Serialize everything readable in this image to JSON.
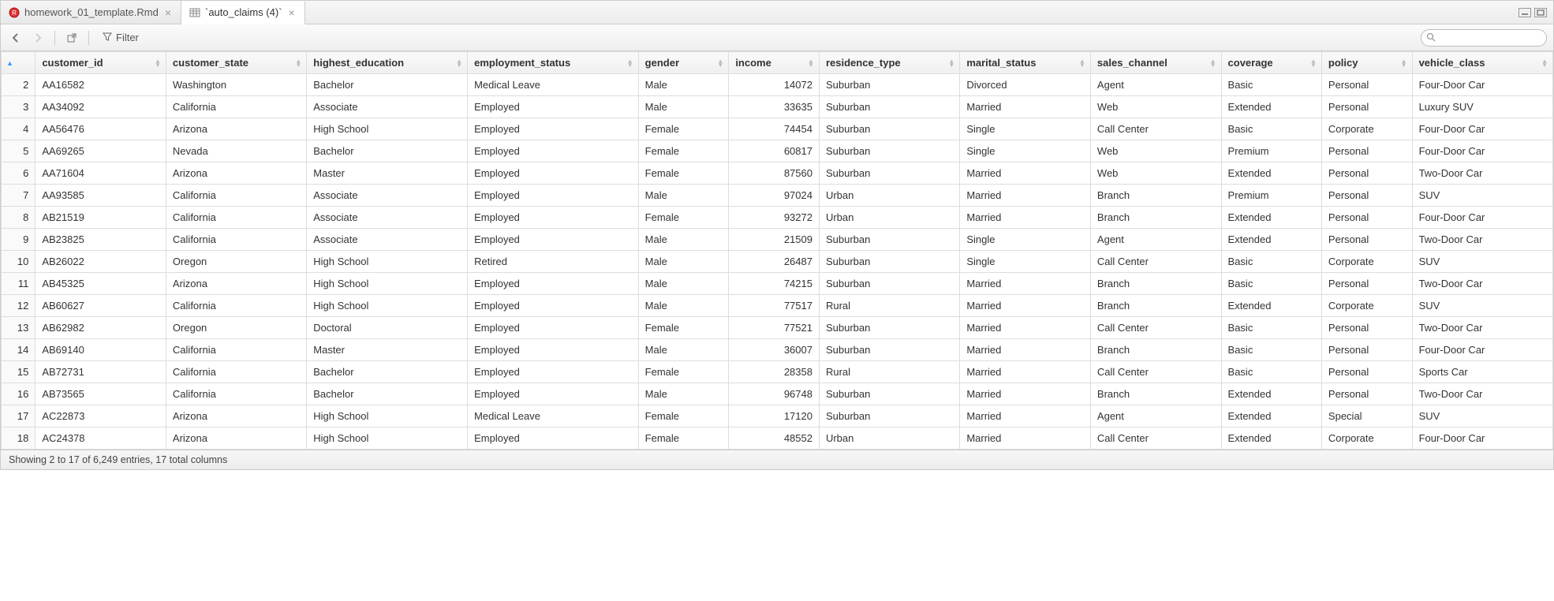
{
  "tabs": [
    {
      "label": "homework_01_template.Rmd",
      "icon": "rmd",
      "active": false
    },
    {
      "label": "`auto_claims (4)`",
      "icon": "table",
      "active": true
    }
  ],
  "toolbar": {
    "filter_label": "Filter",
    "search_placeholder": ""
  },
  "columns": [
    {
      "key": "customer_id",
      "label": "customer_id",
      "type": "text"
    },
    {
      "key": "customer_state",
      "label": "customer_state",
      "type": "text"
    },
    {
      "key": "highest_education",
      "label": "highest_education",
      "type": "text"
    },
    {
      "key": "employment_status",
      "label": "employment_status",
      "type": "text"
    },
    {
      "key": "gender",
      "label": "gender",
      "type": "text"
    },
    {
      "key": "income",
      "label": "income",
      "type": "num"
    },
    {
      "key": "residence_type",
      "label": "residence_type",
      "type": "text"
    },
    {
      "key": "marital_status",
      "label": "marital_status",
      "type": "text"
    },
    {
      "key": "sales_channel",
      "label": "sales_channel",
      "type": "text"
    },
    {
      "key": "coverage",
      "label": "coverage",
      "type": "text"
    },
    {
      "key": "policy",
      "label": "policy",
      "type": "text"
    },
    {
      "key": "vehicle_class",
      "label": "vehicle_class",
      "type": "text"
    }
  ],
  "sorted_column_index": 0,
  "rows": [
    {
      "n": 2,
      "customer_id": "AA16582",
      "customer_state": "Washington",
      "highest_education": "Bachelor",
      "employment_status": "Medical Leave",
      "gender": "Male",
      "income": 14072,
      "residence_type": "Suburban",
      "marital_status": "Divorced",
      "sales_channel": "Agent",
      "coverage": "Basic",
      "policy": "Personal",
      "vehicle_class": "Four-Door Car"
    },
    {
      "n": 3,
      "customer_id": "AA34092",
      "customer_state": "California",
      "highest_education": "Associate",
      "employment_status": "Employed",
      "gender": "Male",
      "income": 33635,
      "residence_type": "Suburban",
      "marital_status": "Married",
      "sales_channel": "Web",
      "coverage": "Extended",
      "policy": "Personal",
      "vehicle_class": "Luxury SUV"
    },
    {
      "n": 4,
      "customer_id": "AA56476",
      "customer_state": "Arizona",
      "highest_education": "High School",
      "employment_status": "Employed",
      "gender": "Female",
      "income": 74454,
      "residence_type": "Suburban",
      "marital_status": "Single",
      "sales_channel": "Call Center",
      "coverage": "Basic",
      "policy": "Corporate",
      "vehicle_class": "Four-Door Car"
    },
    {
      "n": 5,
      "customer_id": "AA69265",
      "customer_state": "Nevada",
      "highest_education": "Bachelor",
      "employment_status": "Employed",
      "gender": "Female",
      "income": 60817,
      "residence_type": "Suburban",
      "marital_status": "Single",
      "sales_channel": "Web",
      "coverage": "Premium",
      "policy": "Personal",
      "vehicle_class": "Four-Door Car"
    },
    {
      "n": 6,
      "customer_id": "AA71604",
      "customer_state": "Arizona",
      "highest_education": "Master",
      "employment_status": "Employed",
      "gender": "Female",
      "income": 87560,
      "residence_type": "Suburban",
      "marital_status": "Married",
      "sales_channel": "Web",
      "coverage": "Extended",
      "policy": "Personal",
      "vehicle_class": "Two-Door Car"
    },
    {
      "n": 7,
      "customer_id": "AA93585",
      "customer_state": "California",
      "highest_education": "Associate",
      "employment_status": "Employed",
      "gender": "Male",
      "income": 97024,
      "residence_type": "Urban",
      "marital_status": "Married",
      "sales_channel": "Branch",
      "coverage": "Premium",
      "policy": "Personal",
      "vehicle_class": "SUV"
    },
    {
      "n": 8,
      "customer_id": "AB21519",
      "customer_state": "California",
      "highest_education": "Associate",
      "employment_status": "Employed",
      "gender": "Female",
      "income": 93272,
      "residence_type": "Urban",
      "marital_status": "Married",
      "sales_channel": "Branch",
      "coverage": "Extended",
      "policy": "Personal",
      "vehicle_class": "Four-Door Car"
    },
    {
      "n": 9,
      "customer_id": "AB23825",
      "customer_state": "California",
      "highest_education": "Associate",
      "employment_status": "Employed",
      "gender": "Male",
      "income": 21509,
      "residence_type": "Suburban",
      "marital_status": "Single",
      "sales_channel": "Agent",
      "coverage": "Extended",
      "policy": "Personal",
      "vehicle_class": "Two-Door Car"
    },
    {
      "n": 10,
      "customer_id": "AB26022",
      "customer_state": "Oregon",
      "highest_education": "High School",
      "employment_status": "Retired",
      "gender": "Male",
      "income": 26487,
      "residence_type": "Suburban",
      "marital_status": "Single",
      "sales_channel": "Call Center",
      "coverage": "Basic",
      "policy": "Corporate",
      "vehicle_class": "SUV"
    },
    {
      "n": 11,
      "customer_id": "AB45325",
      "customer_state": "Arizona",
      "highest_education": "High School",
      "employment_status": "Employed",
      "gender": "Male",
      "income": 74215,
      "residence_type": "Suburban",
      "marital_status": "Married",
      "sales_channel": "Branch",
      "coverage": "Basic",
      "policy": "Personal",
      "vehicle_class": "Two-Door Car"
    },
    {
      "n": 12,
      "customer_id": "AB60627",
      "customer_state": "California",
      "highest_education": "High School",
      "employment_status": "Employed",
      "gender": "Male",
      "income": 77517,
      "residence_type": "Rural",
      "marital_status": "Married",
      "sales_channel": "Branch",
      "coverage": "Extended",
      "policy": "Corporate",
      "vehicle_class": "SUV"
    },
    {
      "n": 13,
      "customer_id": "AB62982",
      "customer_state": "Oregon",
      "highest_education": "Doctoral",
      "employment_status": "Employed",
      "gender": "Female",
      "income": 77521,
      "residence_type": "Suburban",
      "marital_status": "Married",
      "sales_channel": "Call Center",
      "coverage": "Basic",
      "policy": "Personal",
      "vehicle_class": "Two-Door Car"
    },
    {
      "n": 14,
      "customer_id": "AB69140",
      "customer_state": "California",
      "highest_education": "Master",
      "employment_status": "Employed",
      "gender": "Male",
      "income": 36007,
      "residence_type": "Suburban",
      "marital_status": "Married",
      "sales_channel": "Branch",
      "coverage": "Basic",
      "policy": "Personal",
      "vehicle_class": "Four-Door Car"
    },
    {
      "n": 15,
      "customer_id": "AB72731",
      "customer_state": "California",
      "highest_education": "Bachelor",
      "employment_status": "Employed",
      "gender": "Female",
      "income": 28358,
      "residence_type": "Rural",
      "marital_status": "Married",
      "sales_channel": "Call Center",
      "coverage": "Basic",
      "policy": "Personal",
      "vehicle_class": "Sports Car"
    },
    {
      "n": 16,
      "customer_id": "AB73565",
      "customer_state": "California",
      "highest_education": "Bachelor",
      "employment_status": "Employed",
      "gender": "Male",
      "income": 96748,
      "residence_type": "Suburban",
      "marital_status": "Married",
      "sales_channel": "Branch",
      "coverage": "Extended",
      "policy": "Personal",
      "vehicle_class": "Two-Door Car"
    },
    {
      "n": 17,
      "customer_id": "AC22873",
      "customer_state": "Arizona",
      "highest_education": "High School",
      "employment_status": "Medical Leave",
      "gender": "Female",
      "income": 17120,
      "residence_type": "Suburban",
      "marital_status": "Married",
      "sales_channel": "Agent",
      "coverage": "Extended",
      "policy": "Special",
      "vehicle_class": "SUV"
    },
    {
      "n": 18,
      "customer_id": "AC24378",
      "customer_state": "Arizona",
      "highest_education": "High School",
      "employment_status": "Employed",
      "gender": "Female",
      "income": 48552,
      "residence_type": "Urban",
      "marital_status": "Married",
      "sales_channel": "Call Center",
      "coverage": "Extended",
      "policy": "Corporate",
      "vehicle_class": "Four-Door Car"
    }
  ],
  "status": {
    "text": "Showing 2 to 17 of 6,249 entries, 17 total columns"
  }
}
